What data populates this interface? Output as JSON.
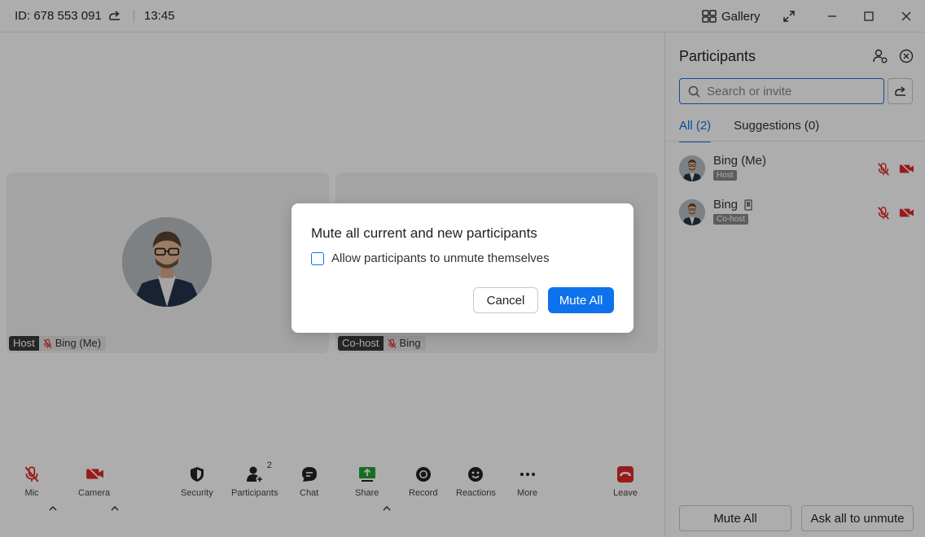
{
  "titlebar": {
    "meeting_id": "ID: 678 553 091",
    "time": "13:45",
    "gallery_label": "Gallery"
  },
  "videos": [
    {
      "role": "Host",
      "name": "Bing (Me)"
    },
    {
      "role": "Co-host",
      "name": "Bing"
    }
  ],
  "toolbar": {
    "mic": "Mic",
    "camera": "Camera",
    "security": "Security",
    "participants": "Participants",
    "participants_count": "2",
    "chat": "Chat",
    "share": "Share",
    "record": "Record",
    "reactions": "Reactions",
    "more": "More",
    "leave": "Leave"
  },
  "panel": {
    "title": "Participants",
    "search_placeholder": "Search or invite",
    "tabs": [
      {
        "label": "All (2)",
        "active": true
      },
      {
        "label": "Suggestions (0)",
        "active": false
      }
    ],
    "participants": [
      {
        "name": "Bing (Me)",
        "role": "Host",
        "device_icon": ""
      },
      {
        "name": "Bing",
        "role": "Co-host",
        "device_icon": "phone-icon"
      }
    ],
    "mute_all": "Mute All",
    "ask_unmute": "Ask all to unmute"
  },
  "dialog": {
    "title": "Mute all current and new participants",
    "checkbox_label": "Allow participants to unmute themselves",
    "checkbox_checked": false,
    "cancel": "Cancel",
    "confirm": "Mute All"
  },
  "colors": {
    "accent": "#0e72ed",
    "danger": "#e02828",
    "share_green": "#23a334"
  }
}
